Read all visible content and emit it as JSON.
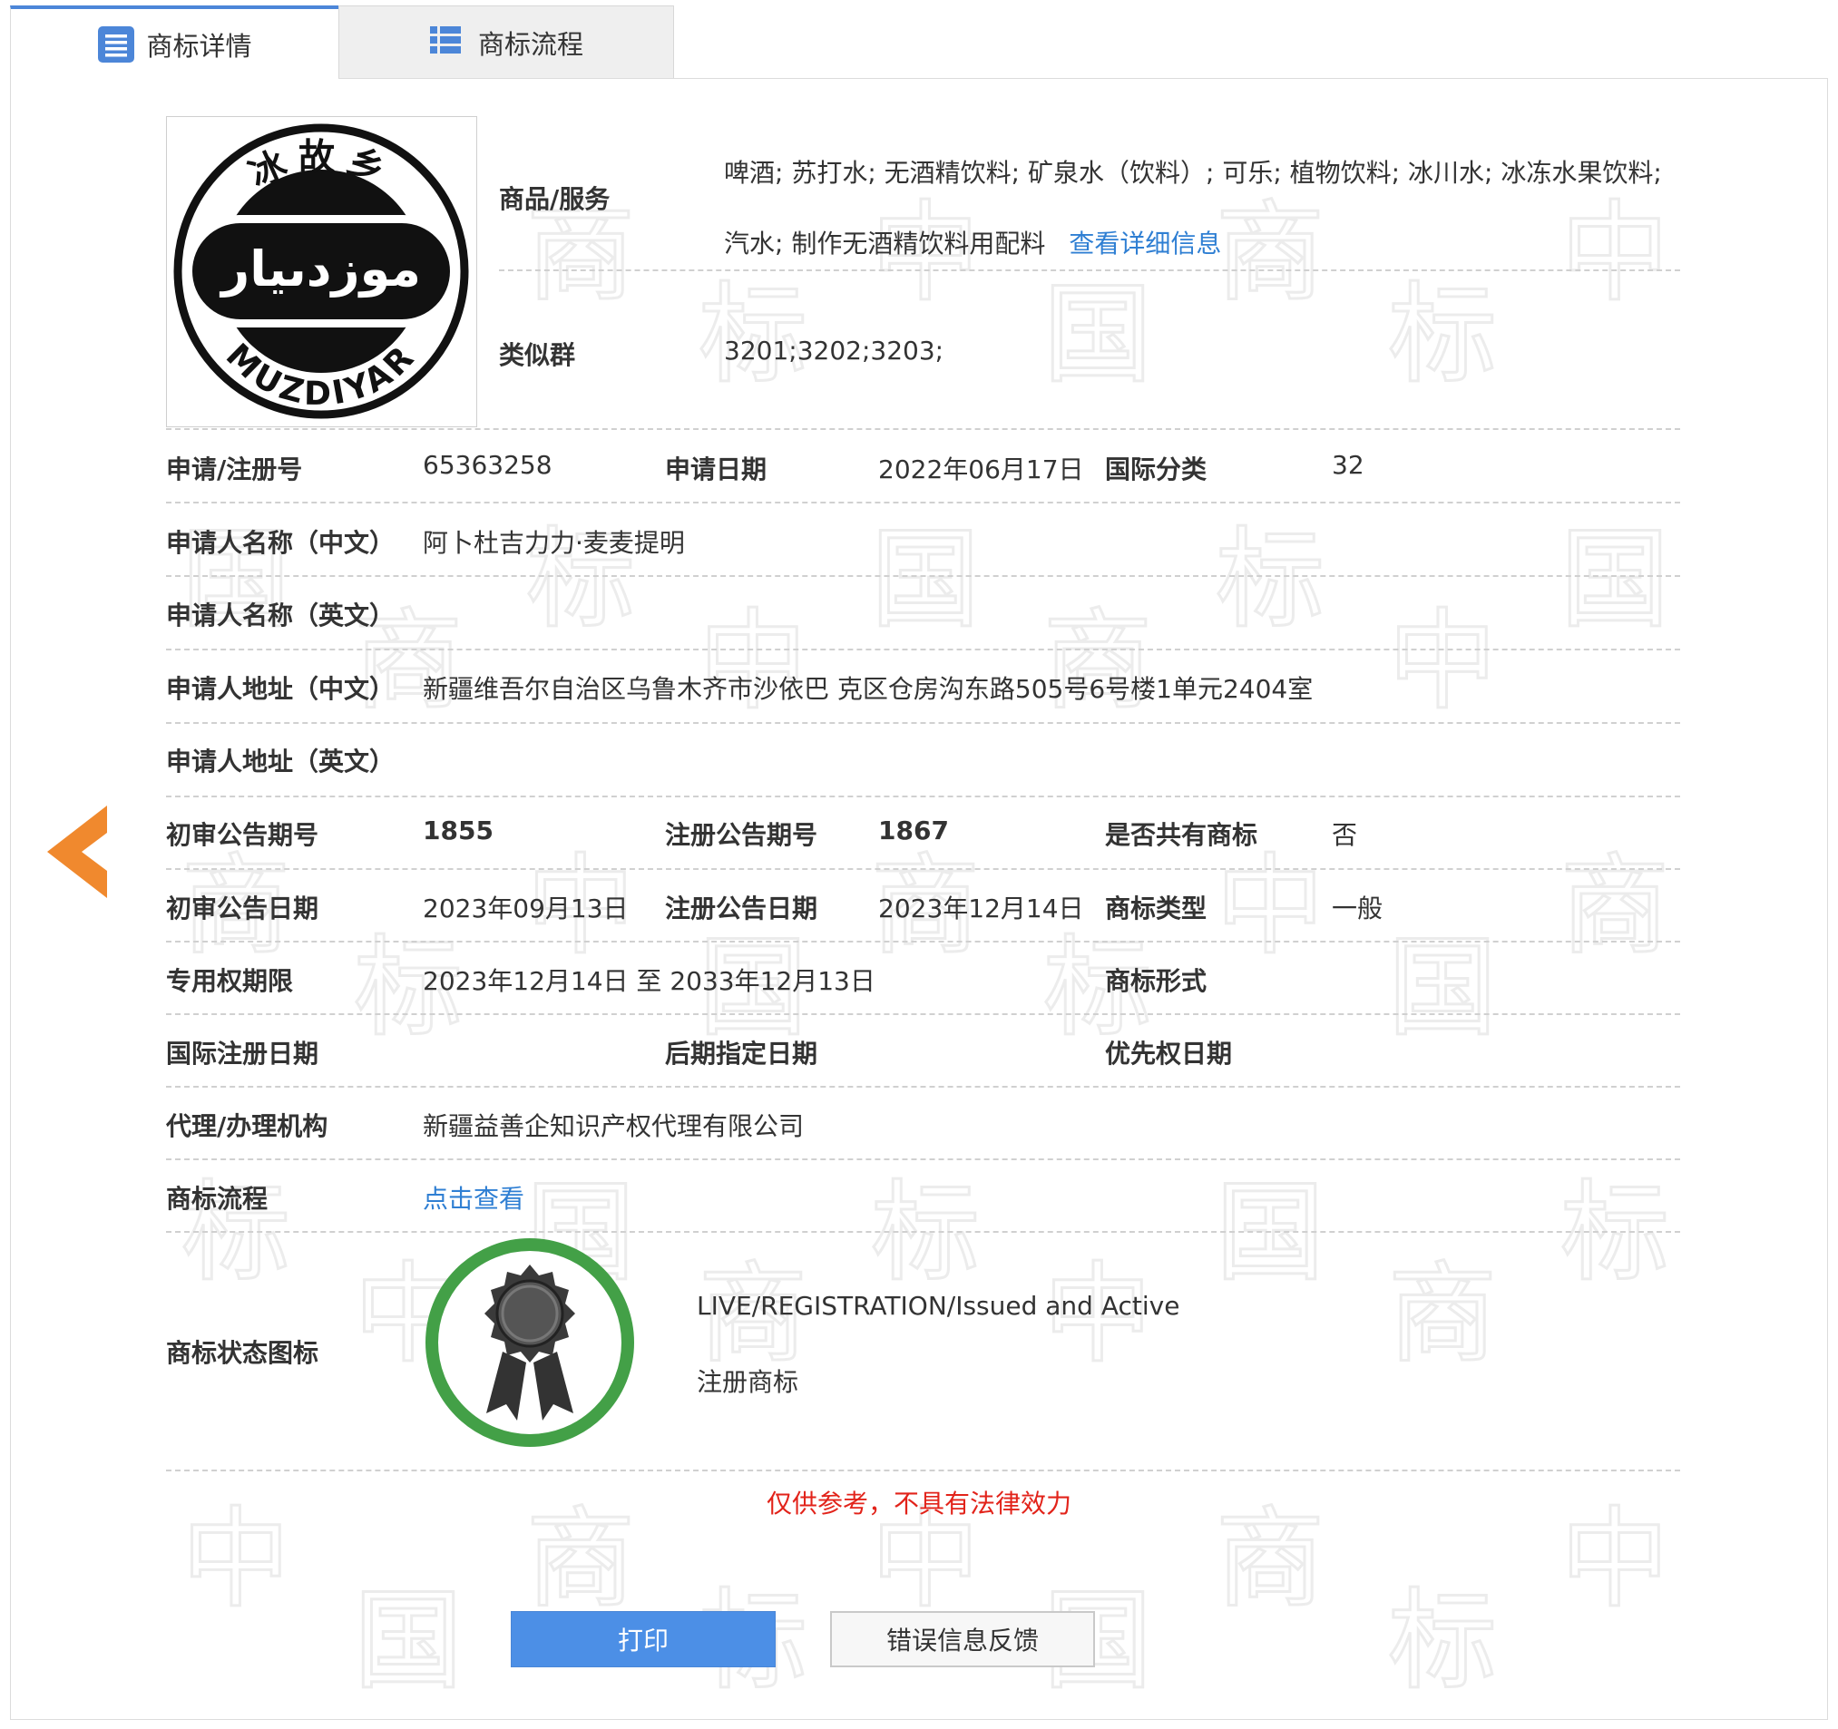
{
  "tabs": [
    {
      "label": "商标详情",
      "icon": "list-detail-icon",
      "active": true
    },
    {
      "label": "商标流程",
      "icon": "grid-list-icon",
      "active": false
    }
  ],
  "logo": {
    "text_top": "冰故乡",
    "text_bottom": "MUZDIYAR",
    "text_arabic": "موزدىيار",
    "icon": "trademark-logo-image"
  },
  "goods_services": {
    "label": "商品/服务",
    "value": "啤酒; 苏打水; 无酒精饮料; 矿泉水（饮料）; 可乐; 植物饮料; 冰川水; 冰冻水果饮料; 汽水; 制作无酒精饮料用配料",
    "link": "查看详细信息"
  },
  "similar_group": {
    "label": "类似群",
    "value": "3201;3202;3203;"
  },
  "rows": {
    "reg_no": {
      "label": "申请/注册号",
      "value": "65363258"
    },
    "apply_date": {
      "label": "申请日期",
      "value": "2022年06月17日"
    },
    "intl_class": {
      "label": "国际分类",
      "value": "32"
    },
    "applicant_cn": {
      "label": "申请人名称（中文）",
      "value": "阿卜杜吉力力·麦麦提明"
    },
    "applicant_en": {
      "label": "申请人名称（英文）",
      "value": ""
    },
    "address_cn": {
      "label": "申请人地址（中文）",
      "value": "新疆维吾尔自治区乌鲁木齐市沙依巴 克区仓房沟东路505号6号楼1单元2404室"
    },
    "address_en": {
      "label": "申请人地址（英文）",
      "value": ""
    },
    "prelim_issue": {
      "label": "初审公告期号",
      "value": "1855"
    },
    "reg_issue": {
      "label": "注册公告期号",
      "value": "1867"
    },
    "shared": {
      "label": "是否共有商标",
      "value": "否"
    },
    "prelim_date": {
      "label": "初审公告日期",
      "value": "2023年09月13日"
    },
    "reg_date": {
      "label": "注册公告日期",
      "value": "2023年12月14日"
    },
    "tm_type": {
      "label": "商标类型",
      "value": "一般"
    },
    "exclusive_period": {
      "label": "专用权期限",
      "value": "2023年12月14日 至 2033年12月13日"
    },
    "tm_form": {
      "label": "商标形式",
      "value": ""
    },
    "intl_reg_date": {
      "label": "国际注册日期",
      "value": ""
    },
    "later_designation": {
      "label": "后期指定日期",
      "value": ""
    },
    "priority_date": {
      "label": "优先权日期",
      "value": ""
    },
    "agency": {
      "label": "代理/办理机构",
      "value": "新疆益善企知识产权代理有限公司"
    },
    "process": {
      "label": "商标流程",
      "link": "点击查看"
    },
    "status": {
      "label": "商标状态图标",
      "en": "LIVE/REGISTRATION/Issued and Active",
      "cn": "注册商标",
      "icon": "registered-award-icon"
    }
  },
  "warning": "仅供参考，不具有法律效力",
  "buttons": {
    "print": "打印",
    "feedback": "错误信息反馈"
  },
  "nav": {
    "back_icon": "back-arrow-icon"
  },
  "watermark": {
    "chars": [
      "中",
      "国",
      "商",
      "标"
    ]
  },
  "colors": {
    "accent": "#4c86d8",
    "link": "#2f7fd3",
    "warning": "#e2231a",
    "arrow": "#f0892e",
    "status_ring": "#43a047"
  }
}
